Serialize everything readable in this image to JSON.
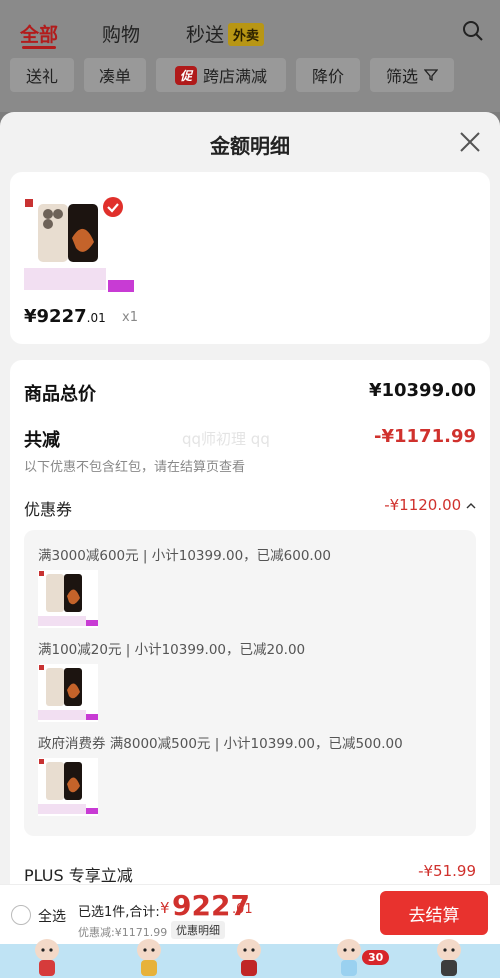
{
  "top_tabs": {
    "all": "全部",
    "shopping": "购物",
    "flash": "秒送",
    "takeout_badge": "外卖"
  },
  "filter_chips": {
    "gift": "送礼",
    "bundle": "凑单",
    "promo_icon": "促",
    "cross_store": "跨店满减",
    "price_drop": "降价",
    "filter": "筛选"
  },
  "sheet": {
    "title": "金额明细"
  },
  "product": {
    "price_int": "¥9227",
    "price_cents": ".01",
    "qty": "x1"
  },
  "details": {
    "total_label": "商品总价",
    "total_value": "¥10399.00",
    "reduce_label": "共减",
    "reduce_value": "-¥1171.99",
    "reduce_note": "以下优惠不包含红包，请在结算页查看",
    "watermark": "qq师初理 qq",
    "coupon_label": "优惠券",
    "coupon_value": "-¥1120.00",
    "coupon_items": [
      "满3000减600元 | 小计10399.00，已减600.00",
      "满100减20元 | 小计10399.00，已减20.00",
      "政府消费券 满8000减500元 | 小计10399.00，已减500.00"
    ],
    "plus_label": "PLUS 专享立减",
    "plus_value": "-¥51.99"
  },
  "bottom": {
    "select_all": "全选",
    "selected_summary": "已选1件,合计:",
    "yen": "¥",
    "total_int": "9227",
    "total_cents": ".01",
    "discount": "优惠减:¥1171.99",
    "detail_link": "优惠明细",
    "checkout": "去结算"
  },
  "mascot_badge": "30",
  "colors": {
    "accent_red": "#e8322e",
    "price_red": "#d0312d"
  }
}
